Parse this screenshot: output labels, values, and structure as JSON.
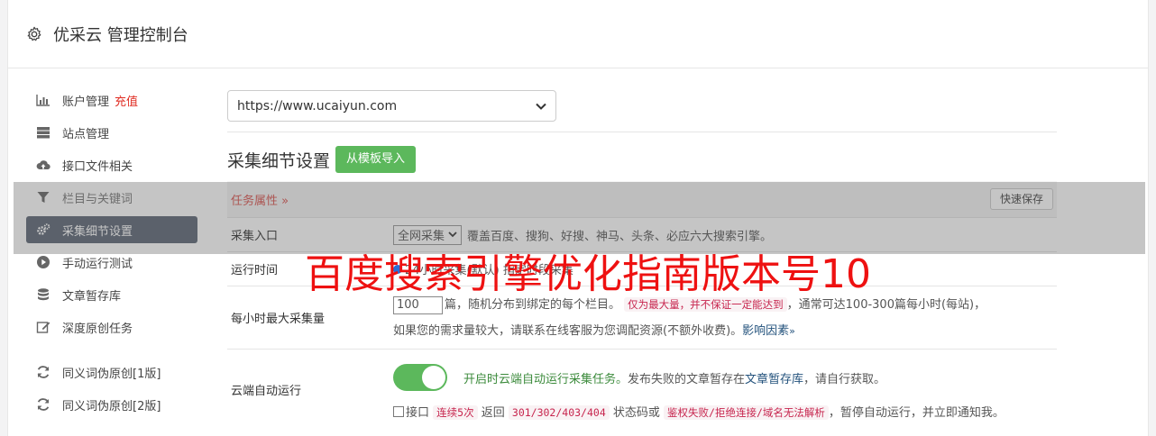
{
  "header": {
    "title": "优采云 管理控制台",
    "icon": "gear-icon"
  },
  "sidebar": {
    "items": [
      {
        "label": "账户管理",
        "extra": "充值",
        "icon": "bar-chart-icon"
      },
      {
        "label": "站点管理",
        "icon": "server-icon"
      },
      {
        "label": "接口文件相关",
        "icon": "cloud-upload-icon"
      },
      {
        "label": "栏目与关键词",
        "icon": "filter-icon"
      },
      {
        "label": "采集细节设置",
        "icon": "gears-icon"
      },
      {
        "label": "手动运行测试",
        "icon": "play-circle-icon"
      },
      {
        "label": "文章暂存库",
        "icon": "database-icon"
      },
      {
        "label": "深度原创任务",
        "icon": "edit-icon"
      },
      {
        "label": "同义词伪原创[1版]",
        "icon": "refresh-icon"
      },
      {
        "label": "同义词伪原创[2版]",
        "icon": "refresh-icon"
      }
    ]
  },
  "main": {
    "site_select_value": "https://www.ucaiyun.com",
    "section_title": "采集细节设置",
    "import_button": "从模板导入",
    "task_attr": "任务属性",
    "save_button": "快速保存",
    "rows": {
      "source": {
        "label": "采集入口",
        "select": "全网采集",
        "desc": "覆盖百度、搜狗、好搜、神马、头条、必应六大搜索引擎。"
      },
      "runtime": {
        "label": "运行时间",
        "desc": "24小时采集(默认)  指定时段采集"
      },
      "max": {
        "label": "每小时最大采集量",
        "value": "100",
        "text1": "篇，随机分布到绑定的每个栏目。",
        "code1": "仅为最大量，并不保证一定能达到",
        "text2": "，通常可达100-300篇每小时(每站)，",
        "text3": "如果您的需求量较大，请联系在线客服为您调配资源(不额外收费)。",
        "link": "影响因素"
      },
      "cloud": {
        "label": "云端自动运行",
        "green": "开启时云端自动运行采集任务。",
        "text1": "发布失败的文章暂存在",
        "link": "文章暂存库",
        "text2": "，请自行获取。",
        "check_label": "接口",
        "code1": "连续5次",
        "text3": "返回",
        "code2": "301/302/403/404",
        "text4": "状态码或",
        "code3": "鉴权失败/拒绝连接/域名无法解析",
        "text5": "，暂停自动运行，并立即通知我。"
      }
    }
  },
  "watermark": "百度搜索引擎优化指南版本号10",
  "colors": {
    "accent_green": "#5cb85c",
    "red": "#e02e24",
    "active_nav": "#5c6675"
  }
}
